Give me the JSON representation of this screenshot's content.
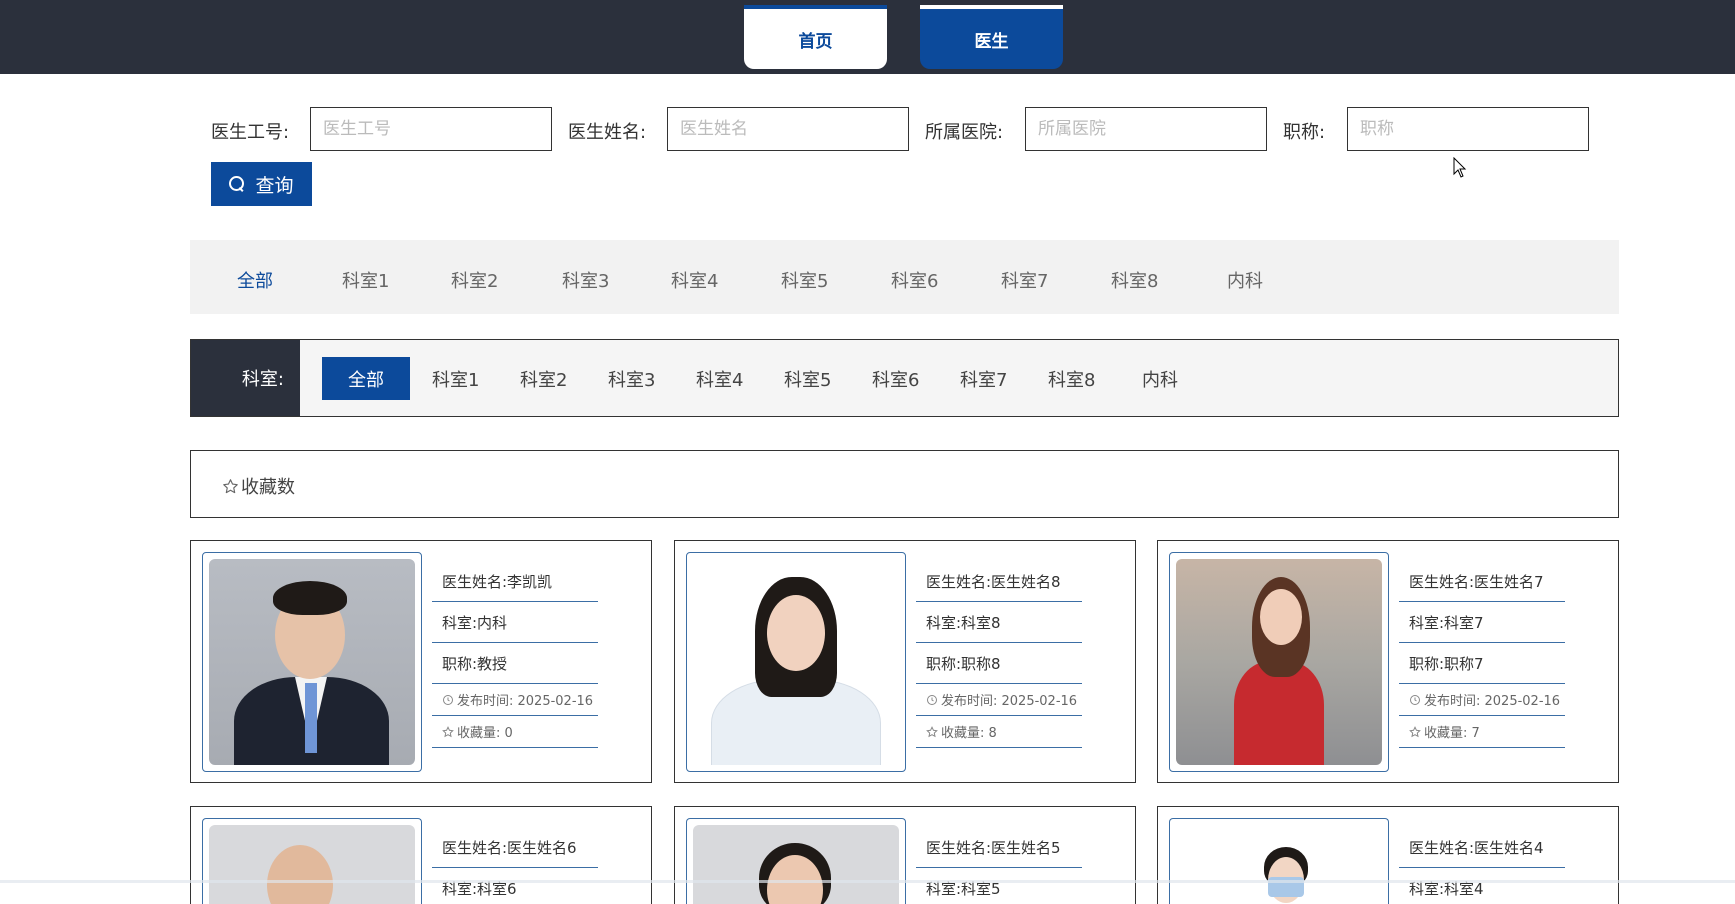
{
  "nav": {
    "home": "首页",
    "doctor": "医生"
  },
  "search": {
    "fields": [
      {
        "label": "医生工号:",
        "placeholder": "医生工号"
      },
      {
        "label": "医生姓名:",
        "placeholder": "医生姓名"
      },
      {
        "label": "所属医院:",
        "placeholder": "所属医院"
      },
      {
        "label": "职称:",
        "placeholder": "职称"
      }
    ],
    "button": "查询"
  },
  "departments_top": [
    "全部",
    "科室1",
    "科室2",
    "科室3",
    "科室4",
    "科室5",
    "科室6",
    "科室7",
    "科室8",
    "内科"
  ],
  "departments_filter": {
    "label": "科室:",
    "items": [
      "全部",
      "科室1",
      "科室2",
      "科室3",
      "科室4",
      "科室5",
      "科室6",
      "科室7",
      "科室8",
      "内科"
    ]
  },
  "sort": {
    "label": "收藏数"
  },
  "doctors": [
    {
      "name": "医生姓名:李凯凯",
      "dept": "科室:内科",
      "title": "职称:教授",
      "published": "发布时间:  2025-02-16",
      "favorites": "收藏量:  0"
    },
    {
      "name": "医生姓名:医生姓名8",
      "dept": "科室:科室8",
      "title": "职称:职称8",
      "published": "发布时间:  2025-02-16",
      "favorites": "收藏量:  8"
    },
    {
      "name": "医生姓名:医生姓名7",
      "dept": "科室:科室7",
      "title": "职称:职称7",
      "published": "发布时间:  2025-02-16",
      "favorites": "收藏量:  7"
    },
    {
      "name": "医生姓名:医生姓名6",
      "dept": "科室:科室6"
    },
    {
      "name": "医生姓名:医生姓名5",
      "dept": "科室:科室5"
    },
    {
      "name": "医生姓名:医生姓名4",
      "dept": "科室:科室4"
    }
  ],
  "colors": {
    "primary": "#0c4a9b",
    "dark": "#2b303c",
    "accent_line": "#3b6ea5"
  },
  "icons": {
    "search": "search-icon",
    "star": "star-outline-icon",
    "clock": "clock-icon"
  }
}
